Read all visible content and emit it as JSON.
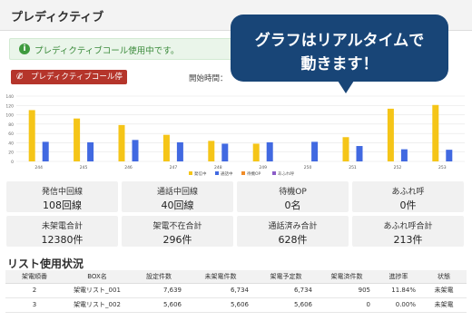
{
  "header": {
    "title": "プレディクティブ"
  },
  "alert": {
    "text": "プレディクティブコール使用中です。"
  },
  "stop_button": {
    "label": "プレディクティブコール停止",
    "icon": "phone-slash-icon"
  },
  "start_time_label": "開始時間：",
  "callout": {
    "line1": "グラフはリアルタイムで",
    "line2": "動きます！"
  },
  "colors": {
    "calling": "#f5c518",
    "talking": "#4169e1",
    "waiting": "#f08c28",
    "overflow": "#8b5cc8",
    "stop": "#b5352b",
    "callout": "#184577"
  },
  "chart_data": {
    "type": "bar",
    "categories": [
      "244",
      "245",
      "246",
      "247",
      "248",
      "249",
      "250",
      "251",
      "252",
      "253"
    ],
    "series": [
      {
        "name": "発信中",
        "color": "#f5c518",
        "values": [
          110,
          92,
          78,
          57,
          44,
          38,
          0,
          52,
          113,
          121
        ]
      },
      {
        "name": "通話中",
        "color": "#4169e1",
        "values": [
          42,
          41,
          46,
          41,
          38,
          41,
          42,
          33,
          26,
          25
        ]
      },
      {
        "name": "待機OP",
        "color": "#f08c28",
        "values": [
          0,
          0,
          0,
          0,
          0,
          0,
          0,
          0,
          0,
          0
        ]
      },
      {
        "name": "あふれ呼",
        "color": "#8b5cc8",
        "values": [
          0,
          0,
          0,
          0,
          0,
          0,
          0,
          0,
          0,
          0
        ]
      }
    ],
    "yticks": [
      "0",
      "20",
      "40",
      "60",
      "80",
      "100",
      "120",
      "140"
    ],
    "ylim": [
      0,
      140
    ],
    "grid": true,
    "legend": "bottom"
  },
  "stats": [
    {
      "label": "発信中回線",
      "value": "108回線"
    },
    {
      "label": "通話中回線",
      "value": "40回線"
    },
    {
      "label": "待機OP",
      "value": "0名"
    },
    {
      "label": "あふれ呼",
      "value": "0件"
    },
    {
      "label": "未架電合計",
      "value": "12380件"
    },
    {
      "label": "架電不在合計",
      "value": "296件"
    },
    {
      "label": "通話済み合計",
      "value": "628件"
    },
    {
      "label": "あふれ呼合計",
      "value": "213件"
    }
  ],
  "list_section": {
    "title": "リスト使用状況",
    "columns": [
      "架電順番",
      "BOX名",
      "設定件数",
      "未架電件数",
      "架電予定数",
      "架電済件数",
      "進捗率",
      "状態"
    ],
    "rows": [
      [
        "2",
        "架電リスト_001",
        "7,639",
        "6,734",
        "6,734",
        "905",
        "11.84%",
        "未架電"
      ],
      [
        "3",
        "架電リスト_002",
        "5,606",
        "5,606",
        "5,606",
        "0",
        "0.00%",
        "未架電"
      ]
    ]
  }
}
